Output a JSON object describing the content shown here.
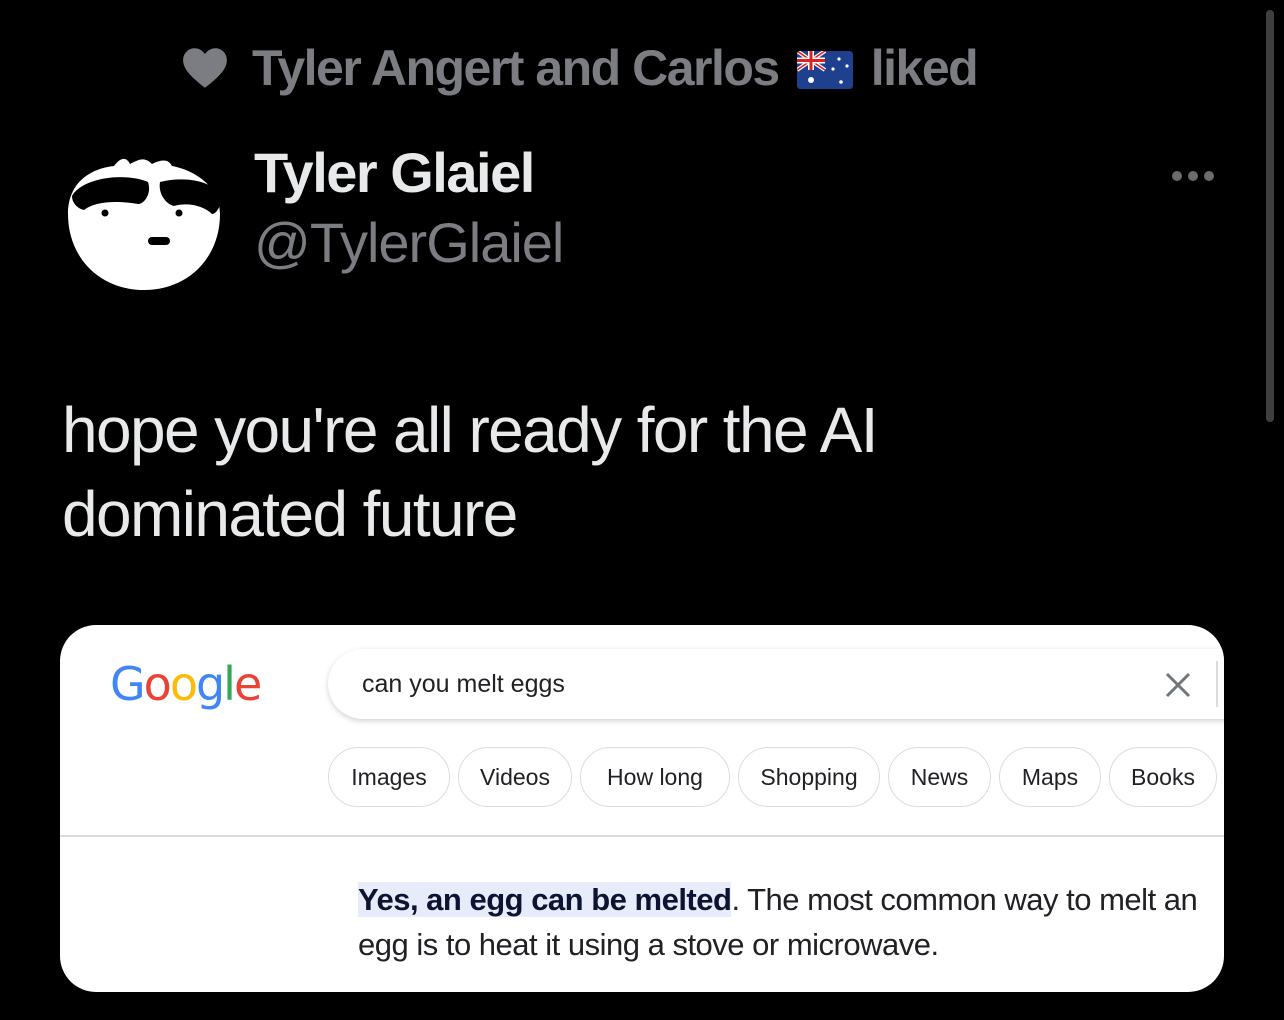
{
  "social_context": {
    "icon": "heart-icon",
    "text_before_flag": "Tyler Angert and Carlos",
    "flag_emoji": "australia-flag",
    "text_after_flag": "liked",
    "color": "#7b7d82"
  },
  "author": {
    "display_name": "Tyler Glaiel",
    "handle": "@TylerGlaiel",
    "avatar": "cartoon-face-avatar"
  },
  "more_menu": {
    "icon": "more-horizontal-icon"
  },
  "tweet": {
    "text": "hope you're all ready for the AI dominated future"
  },
  "embedded_screenshot": {
    "logo": {
      "letters": [
        {
          "char": "G",
          "color": "#4285F4"
        },
        {
          "char": "o",
          "color": "#EA4335"
        },
        {
          "char": "o",
          "color": "#FBBC05"
        },
        {
          "char": "g",
          "color": "#4285F4"
        },
        {
          "char": "l",
          "color": "#34A853"
        },
        {
          "char": "e",
          "color": "#EA4335"
        }
      ]
    },
    "search": {
      "query": "can you melt eggs",
      "clear_icon": "close-icon"
    },
    "chips": [
      "Images",
      "Videos",
      "How long",
      "Shopping",
      "News",
      "Maps",
      "Books"
    ],
    "answer": {
      "highlight": "Yes, an egg can be melted",
      "rest": ". The most common way to melt an egg is to heat it using a stove or microwave.",
      "highlight_bg": "#e8ebfa"
    }
  }
}
